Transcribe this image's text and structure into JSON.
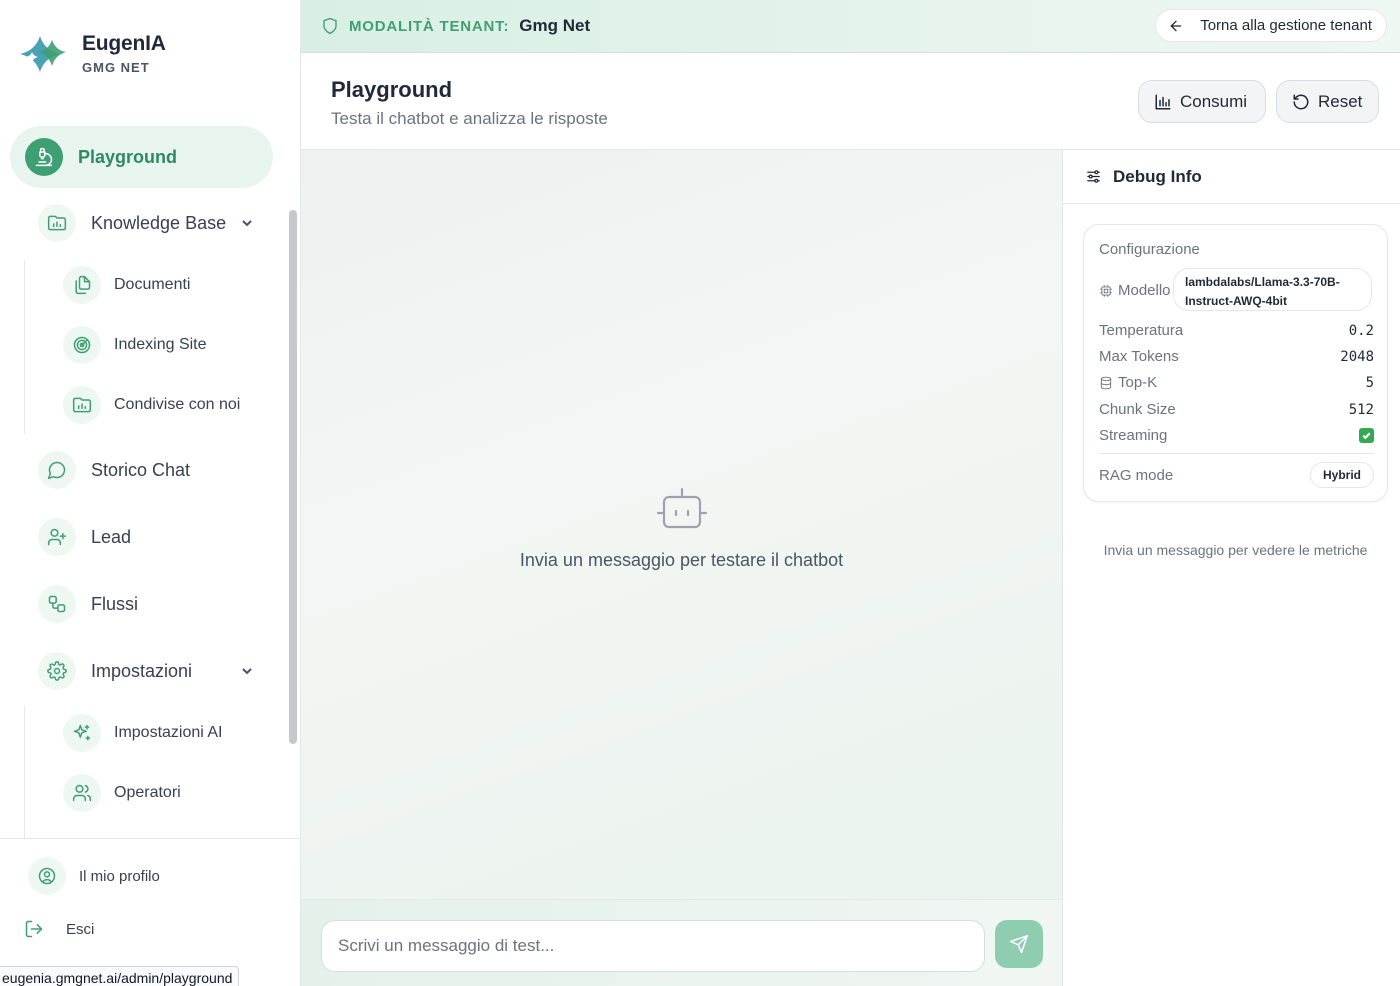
{
  "brand": {
    "name": "EugenIA",
    "tenant": "GMG NET"
  },
  "colors": {
    "accent": "#3f9f74",
    "accent_light": "#e8f5ee",
    "send": "#8fcdb0"
  },
  "sidebar": {
    "active": {
      "label": "Playground",
      "icon": "flask-icon"
    },
    "items": [
      {
        "label": "Knowledge Base",
        "icon": "folder-chart-icon",
        "expanded": true
      },
      {
        "label": "Documenti",
        "icon": "documents-icon"
      },
      {
        "label": "Indexing Site",
        "icon": "radar-icon"
      },
      {
        "label": "Condivise con noi",
        "icon": "folder-chart-icon"
      },
      {
        "label": "Storico Chat",
        "icon": "chat-bubble-icon"
      },
      {
        "label": "Lead",
        "icon": "user-plus-icon"
      },
      {
        "label": "Flussi",
        "icon": "workflow-icon"
      },
      {
        "label": "Impostazioni",
        "icon": "gear-icon",
        "expanded": true
      },
      {
        "label": "Impostazioni AI",
        "icon": "sparkles-icon"
      },
      {
        "label": "Operatori",
        "icon": "users-icon"
      }
    ],
    "profile_label": "Il mio profilo",
    "logout_label": "Esci"
  },
  "status_url": "eugenia.gmgnet.ai/admin/playground",
  "tenant_bar": {
    "label": "MODALITÀ TENANT:",
    "name": "Gmg Net",
    "back_label": "Torna alla gestione tenant"
  },
  "header": {
    "title": "Playground",
    "subtitle": "Testa il chatbot e analizza le risposte",
    "usage_label": "Consumi",
    "reset_label": "Reset"
  },
  "chat": {
    "empty_text": "Invia un messaggio per testare il chatbot",
    "input_placeholder": "Scrivi un messaggio di test...",
    "input_value": ""
  },
  "debug": {
    "title": "Debug Info",
    "config_title": "Configurazione",
    "model_label": "Modello",
    "model_value_line1": "lambdalabs/Llama-3.3-70B-",
    "model_value_line2": "Instruct-AWQ-4bit",
    "rows": [
      {
        "key": "Temperatura",
        "value": "0.2"
      },
      {
        "key": "Max Tokens",
        "value": "2048"
      },
      {
        "key": "Top-K",
        "value": "5"
      },
      {
        "key": "Chunk Size",
        "value": "512"
      }
    ],
    "streaming_label": "Streaming",
    "streaming_on": true,
    "rag_label": "RAG mode",
    "rag_value": "Hybrid",
    "metrics_hint": "Invia un messaggio per vedere le metriche"
  }
}
